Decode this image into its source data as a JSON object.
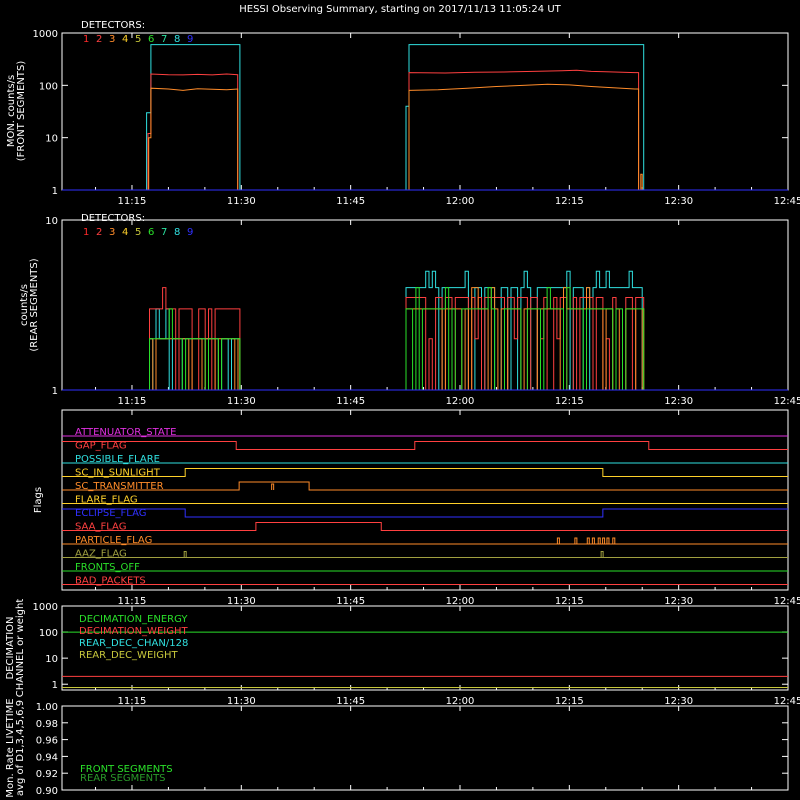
{
  "title": "HESSI Observing Summary, starting on 2017/11/13 11:05:24 UT",
  "time_axis": {
    "unit": "minutes since 11:00 UT",
    "range": [
      5.4,
      105
    ],
    "ticks": [
      {
        "t": 15,
        "label": "11:15"
      },
      {
        "t": 30,
        "label": "11:30"
      },
      {
        "t": 45,
        "label": "11:45"
      },
      {
        "t": 60,
        "label": "12:00"
      },
      {
        "t": 75,
        "label": "12:15"
      },
      {
        "t": 90,
        "label": "12:30"
      },
      {
        "t": 105,
        "label": "12:45"
      }
    ]
  },
  "colors": {
    "d1": "#ff2a2a",
    "d2": "#ff4040",
    "d3": "#ff8c2a",
    "d4": "#ffd12a",
    "d5": "#c8c83c",
    "d6": "#2ae02a",
    "d7": "#2ae0a0",
    "d8": "#30e0e0",
    "d9": "#3030ff",
    "magenta": "#e030e0",
    "olive": "#a0a040"
  },
  "detector_legend": {
    "header": "DETECTORS:",
    "numbers": [
      "1",
      "2",
      "3",
      "4",
      "5",
      "6",
      "7",
      "8",
      "9"
    ]
  },
  "chart_data": [
    {
      "type": "line",
      "panel": "front",
      "ylabel_lines": [
        "MON. counts/s",
        "(FRONT SEGMENTS)"
      ],
      "yscale": "log",
      "ylim": [
        1,
        1000
      ],
      "ytick_labels": [
        "1",
        "10",
        "100",
        "1000"
      ],
      "ytick_values": [
        1,
        10,
        100,
        1000
      ],
      "series": [
        {
          "color": "#30e0e0",
          "points": [
            [
              5.4,
              1
            ],
            [
              17,
              1
            ],
            [
              17,
              30
            ],
            [
              17.6,
              30
            ],
            [
              17.6,
              600
            ],
            [
              29.8,
              600
            ],
            [
              29.8,
              1
            ],
            [
              52.6,
              1
            ],
            [
              52.6,
              40
            ],
            [
              53,
              40
            ],
            [
              53,
              600
            ],
            [
              85.2,
              600
            ],
            [
              85.2,
              1
            ],
            [
              105,
              1
            ]
          ]
        },
        {
          "color": "#ff4040",
          "points": [
            [
              5.4,
              1
            ],
            [
              17.2,
              1
            ],
            [
              17.2,
              12
            ],
            [
              17.6,
              12
            ],
            [
              17.6,
              165
            ],
            [
              20,
              160
            ],
            [
              22,
              158
            ],
            [
              24,
              162
            ],
            [
              26,
              158
            ],
            [
              28,
              165
            ],
            [
              29.5,
              160
            ],
            [
              29.5,
              1
            ],
            [
              53,
              1
            ],
            [
              53,
              175
            ],
            [
              58,
              172
            ],
            [
              62,
              178
            ],
            [
              66,
              180
            ],
            [
              70,
              185
            ],
            [
              74,
              190
            ],
            [
              76,
              195
            ],
            [
              78,
              185
            ],
            [
              80,
              182
            ],
            [
              84,
              175
            ],
            [
              84.5,
              175
            ],
            [
              84.5,
              1
            ],
            [
              105,
              1
            ]
          ]
        },
        {
          "color": "#ff8c2a",
          "points": [
            [
              5.4,
              1
            ],
            [
              17.3,
              1
            ],
            [
              17.3,
              10
            ],
            [
              17.6,
              10
            ],
            [
              17.6,
              88
            ],
            [
              20,
              85
            ],
            [
              22,
              80
            ],
            [
              24,
              86
            ],
            [
              26,
              84
            ],
            [
              28,
              82
            ],
            [
              29.5,
              85
            ],
            [
              29.5,
              1
            ],
            [
              53,
              1
            ],
            [
              53,
              80
            ],
            [
              57,
              82
            ],
            [
              61,
              88
            ],
            [
              65,
              95
            ],
            [
              69,
              100
            ],
            [
              72,
              105
            ],
            [
              75,
              102
            ],
            [
              78,
              95
            ],
            [
              81,
              90
            ],
            [
              84,
              85
            ],
            [
              84.5,
              85
            ],
            [
              84.5,
              1
            ],
            [
              84.8,
              1
            ],
            [
              84.8,
              2
            ],
            [
              85,
              2
            ],
            [
              85,
              1
            ],
            [
              105,
              1
            ]
          ]
        },
        {
          "color": "#3030ff",
          "points": [
            [
              5.4,
              1
            ],
            [
              105,
              1
            ]
          ]
        }
      ]
    },
    {
      "type": "line",
      "panel": "rear",
      "ylabel_lines": [
        "counts/s",
        "(REAR SEGMENTS)"
      ],
      "yscale": "log",
      "ylim": [
        1,
        10
      ],
      "ytick_labels": [
        "1",
        "10"
      ],
      "ytick_values": [
        1,
        10
      ],
      "series": [
        {
          "color": "#30e0e0",
          "segments": [
            [
              17.4,
              29.8,
              2
            ],
            [
              52.6,
              85.2,
              4
            ]
          ]
        },
        {
          "color": "#ff4040",
          "segments": [
            [
              17.4,
              29.8,
              3
            ],
            [
              52.6,
              85.2,
              3.5
            ]
          ]
        },
        {
          "color": "#ff8c2a",
          "segments": [
            [
              17.4,
              29.8,
              2
            ],
            [
              52.6,
              85.2,
              3
            ]
          ]
        },
        {
          "color": "#2ae02a",
          "segments": [
            [
              17.4,
              29.8,
              2
            ],
            [
              52.6,
              85.2,
              3
            ]
          ]
        },
        {
          "color": "#3030ff",
          "segments": [
            [
              5.4,
              105,
              1
            ]
          ]
        }
      ]
    },
    {
      "type": "line",
      "panel": "flags",
      "ylabel": "Flags",
      "flags": [
        {
          "label": "ATTENUATOR_STATE",
          "color": "#e030e0",
          "level": 0,
          "changes": []
        },
        {
          "label": "GAP_FLAG",
          "color": "#ff4040",
          "changes": [
            [
              5.4,
              1
            ],
            [
              29.3,
              0
            ],
            [
              53.8,
              1
            ],
            [
              85.9,
              0
            ]
          ]
        },
        {
          "label": "POSSIBLE_FLARE",
          "color": "#30e0e0",
          "changes": []
        },
        {
          "label": "SC_IN_SUNLIGHT",
          "color": "#ffd12a",
          "changes": [
            [
              5.4,
              0
            ],
            [
              22.3,
              1
            ],
            [
              79.6,
              0
            ]
          ]
        },
        {
          "label": "SC_TRANSMITTER",
          "color": "#ff8c2a",
          "changes": [
            [
              5.4,
              0
            ],
            [
              29.7,
              1
            ],
            [
              39.3,
              0
            ]
          ],
          "spikes": [
            34.3
          ]
        },
        {
          "label": "FLARE_FLAG",
          "color": "#ffd12a",
          "changes": []
        },
        {
          "label": "ECLIPSE_FLAG",
          "color": "#3030ff",
          "changes": [
            [
              5.4,
              1
            ],
            [
              22.3,
              0
            ],
            [
              79.6,
              1
            ]
          ]
        },
        {
          "label": "SAA_FLAG",
          "color": "#ff4040",
          "changes": [
            [
              5.4,
              0
            ],
            [
              32,
              1
            ],
            [
              49.2,
              0
            ]
          ]
        },
        {
          "label": "PARTICLE_FLAG",
          "color": "#ff8c2a",
          "changes": [],
          "spikes": [
            73.5,
            75.9,
            77.6,
            78.3,
            79.1,
            79.7,
            80.3,
            81.1
          ]
        },
        {
          "label": "AAZ_FLAG",
          "color": "#a0a040",
          "changes": [],
          "spikes": [
            22.3,
            79.5
          ]
        },
        {
          "label": "FRONTS_OFF",
          "color": "#2ae02a",
          "changes": []
        },
        {
          "label": "BAD_PACKETS",
          "color": "#ff4040",
          "changes": []
        }
      ]
    },
    {
      "type": "line",
      "panel": "decimation",
      "ylabel_lines": [
        "DECIMATION",
        "CHANNEL or weight"
      ],
      "yscale": "log",
      "ylim": [
        0.6,
        1000
      ],
      "ytick_labels": [
        "1",
        "10",
        "100",
        "1000"
      ],
      "ytick_values": [
        1,
        10,
        100,
        1000
      ],
      "series": [
        {
          "label": "DECIMATION_ENERGY",
          "color": "#2ae02a",
          "value": 100
        },
        {
          "label": "DECIMATION_WEIGHT",
          "color": "#ff4040",
          "value": 2
        },
        {
          "label": "REAR_DEC_CHAN/128",
          "color": "#30e0e0",
          "value": null
        },
        {
          "label": "REAR_DEC_WEIGHT",
          "color": "#c8c83c",
          "value": 0.75
        }
      ]
    },
    {
      "type": "line",
      "panel": "livetime",
      "ylabel_lines": [
        "Mon. Rate LIVETIME",
        "avg of D1,3,4,5,6,9"
      ],
      "ylim": [
        0.9,
        1.0
      ],
      "ytick_labels": [
        "0.90",
        "0.92",
        "0.94",
        "0.96",
        "0.98",
        "1.00"
      ],
      "ytick_values": [
        0.9,
        0.92,
        0.94,
        0.96,
        0.98,
        1.0
      ],
      "series": [
        {
          "label": "FRONT SEGMENTS",
          "color": "#2ae02a"
        },
        {
          "label": "REAR SEGMENTS",
          "color": "#2a9a2a"
        }
      ]
    }
  ]
}
